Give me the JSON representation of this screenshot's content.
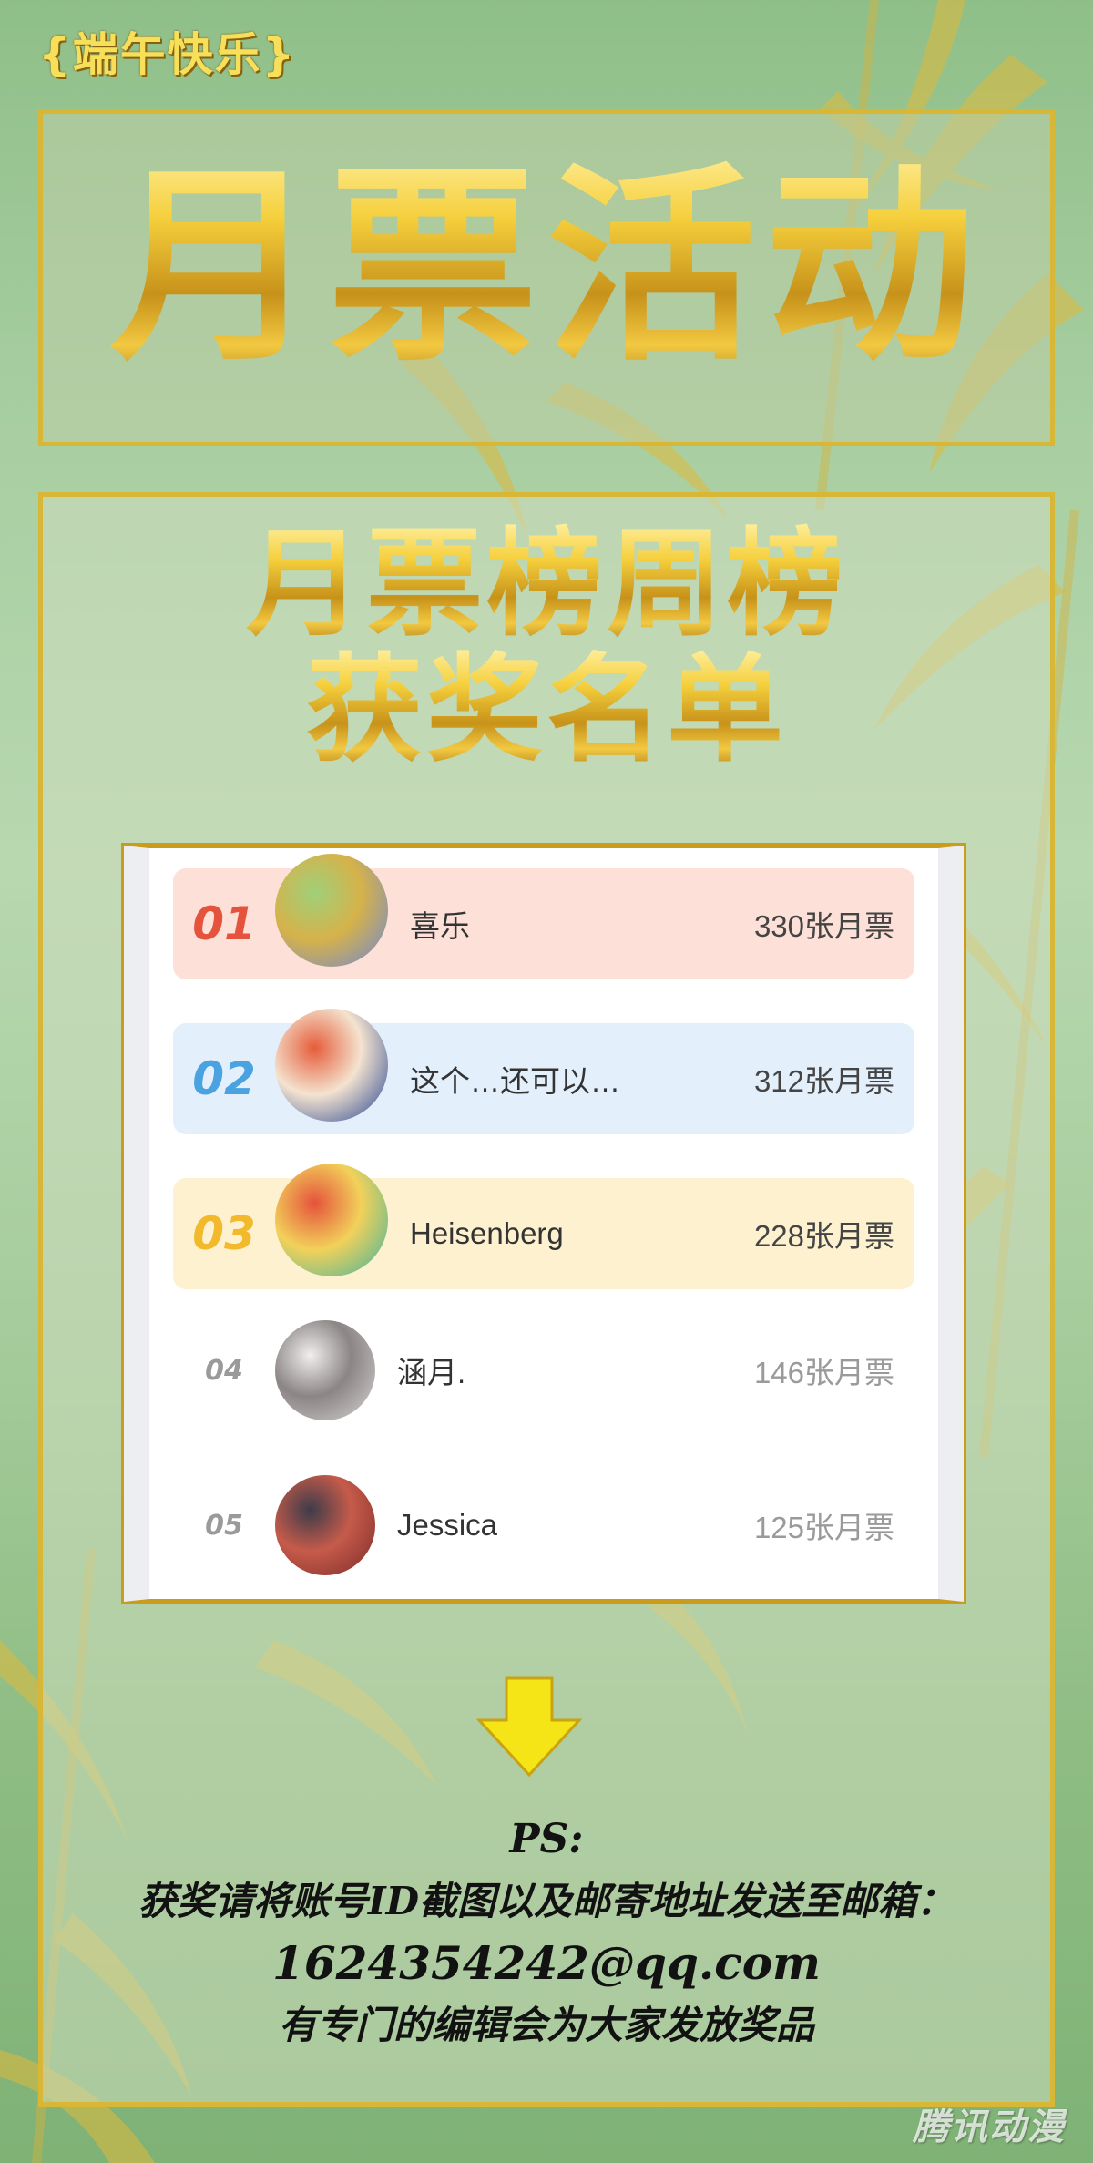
{
  "header": {
    "tag": "{端午快乐}",
    "title": "月票活动"
  },
  "panel": {
    "subtitle_line1": "月票榜周榜",
    "subtitle_line2": "获奖名单"
  },
  "ranking": [
    {
      "rank": "01",
      "name": "喜乐",
      "votes": "330张月票",
      "bg": "#fde0d8",
      "num_color": "#e5533c",
      "avatar_colors": [
        "#6c86d8",
        "#d6b24a",
        "#9fd07a"
      ]
    },
    {
      "rank": "02",
      "name": "这个…还可以…",
      "votes": "312张月票",
      "bg": "#e3f0fc",
      "num_color": "#4aa3e0",
      "avatar_colors": [
        "#1f3f8f",
        "#f4e3cf",
        "#e65c3a"
      ]
    },
    {
      "rank": "03",
      "name": "Heisenberg",
      "votes": "228张月票",
      "bg": "#fdf1cf",
      "num_color": "#f2b92a",
      "avatar_colors": [
        "#3bb3a1",
        "#f2d15a",
        "#e5533c"
      ]
    },
    {
      "rank": "04",
      "name": "涵月.",
      "votes": "146张月票",
      "bg": "#ffffff",
      "num_color": "#9a9a9a",
      "avatar_colors": [
        "#d9d6d6",
        "#8b8585",
        "#f1eeee"
      ]
    },
    {
      "rank": "05",
      "name": "Jessica",
      "votes": "125张月票",
      "bg": "#ffffff",
      "num_color": "#9a9a9a",
      "avatar_colors": [
        "#7a2a2a",
        "#c65b4a",
        "#3d3b4a"
      ]
    }
  ],
  "ps": {
    "label": "PS:",
    "line1": "获奖请将账号ID截图以及邮寄地址发送至邮箱：",
    "email": "1624354242@qq.com",
    "line3": "有专门的编辑会为大家发放奖品"
  },
  "watermark": "腾讯动漫"
}
